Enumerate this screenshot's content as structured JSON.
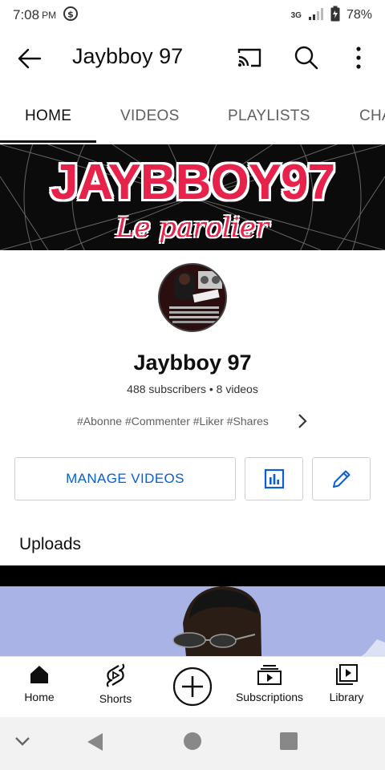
{
  "status_bar": {
    "time": "7:08",
    "ampm": "PM",
    "network": "3G",
    "battery": "78%"
  },
  "app_bar": {
    "title": "Jaybboy 97"
  },
  "tabs": [
    {
      "label": "HOME",
      "active": true
    },
    {
      "label": "VIDEOS",
      "active": false
    },
    {
      "label": "PLAYLISTS",
      "active": false
    },
    {
      "label": "CHA",
      "active": false
    }
  ],
  "banner": {
    "title": "JAYBBOY97",
    "subtitle": "Le parolier"
  },
  "channel": {
    "name": "Jaybboy 97",
    "meta": "488 subscribers • 8 videos",
    "tags": "#Abonne #Commenter #Liker #Shares"
  },
  "actions": {
    "manage_label": "MANAGE VIDEOS"
  },
  "uploads": {
    "heading": "Uploads"
  },
  "bottom_nav": {
    "items": [
      {
        "label": "Home",
        "icon": "home-icon"
      },
      {
        "label": "Shorts",
        "icon": "shorts-icon"
      },
      {
        "label": "",
        "icon": "create-icon"
      },
      {
        "label": "Subscriptions",
        "icon": "subscriptions-icon"
      },
      {
        "label": "Library",
        "icon": "library-icon"
      }
    ]
  },
  "colors": {
    "accent_blue": "#065fd4",
    "banner_red": "#e8234b",
    "text_primary": "#0f0f0f",
    "text_secondary": "#606060"
  }
}
